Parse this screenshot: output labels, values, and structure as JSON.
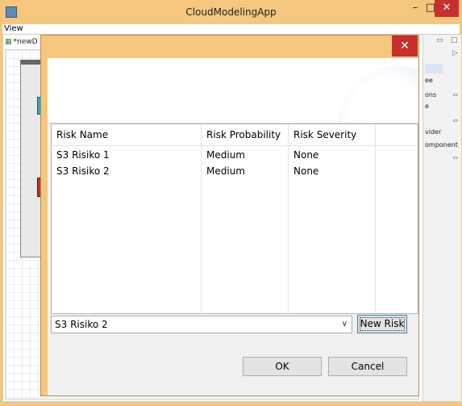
{
  "app": {
    "title": "CloudModelingApp",
    "window_controls": {
      "minimize": "–",
      "maximize": "□",
      "close": "✕"
    }
  },
  "menubar": {
    "items": [
      "View"
    ]
  },
  "editor": {
    "tab_label": "*newD"
  },
  "right_panel": {
    "items": [
      "ee",
      "ons",
      "e",
      "vider",
      "omponent"
    ]
  },
  "dialog": {
    "close_label": "✕",
    "table": {
      "columns": [
        "Risk Name",
        "Risk Probability",
        "Risk Severity",
        ""
      ],
      "rows": [
        {
          "name": "S3 Risiko 1",
          "probability": "Medium",
          "severity": "None"
        },
        {
          "name": "S3 Risiko 2",
          "probability": "Medium",
          "severity": "None"
        }
      ]
    },
    "risk_select": {
      "value": "S3 Risiko 2"
    },
    "new_risk_label": "New Risk",
    "ok_label": "OK",
    "cancel_label": "Cancel"
  },
  "colors": {
    "window_frame": "#f5c77e",
    "close_button": "#c7302c",
    "diagram_cyan": "#33a4c9",
    "diagram_red": "#c2302f"
  }
}
